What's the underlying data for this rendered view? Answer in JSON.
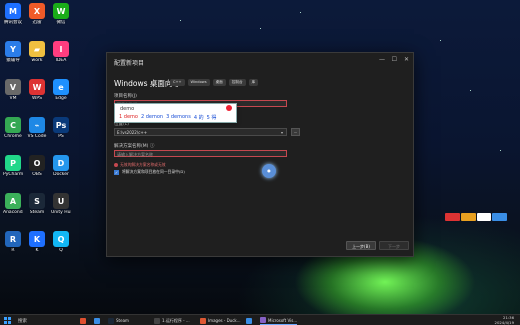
{
  "desktop_icons": [
    {
      "label": "腾讯会议",
      "color": "#1e6fff",
      "glyph": "M"
    },
    {
      "label": "迅雷",
      "color": "#f05a28",
      "glyph": "X"
    },
    {
      "label": "微信",
      "color": "#1aad19",
      "glyph": "W"
    },
    {
      "label": "猿辅导",
      "color": "#2b7de9",
      "glyph": "Y"
    },
    {
      "label": "work",
      "color": "#f0c040",
      "glyph": "▰"
    },
    {
      "label": "IDEA",
      "color": "#ff3d7f",
      "glyph": "I"
    },
    {
      "label": "VM",
      "color": "#696969",
      "glyph": "V"
    },
    {
      "label": "WPS",
      "color": "#d33",
      "glyph": "W"
    },
    {
      "label": "Edge",
      "color": "#1e90ff",
      "glyph": "e"
    },
    {
      "label": "Chrome",
      "color": "#34a853",
      "glyph": "C"
    },
    {
      "label": "VS Code",
      "color": "#1e88e5",
      "glyph": "⌁"
    },
    {
      "label": "PS",
      "color": "#0a3a7a",
      "glyph": "Ps"
    },
    {
      "label": "PyCharm",
      "color": "#21d789",
      "glyph": "P"
    },
    {
      "label": "OBS",
      "color": "#222",
      "glyph": "O"
    },
    {
      "label": "Docker",
      "color": "#2496ed",
      "glyph": "D"
    },
    {
      "label": "Anaconda",
      "color": "#3bb05a",
      "glyph": "A"
    },
    {
      "label": "Steam",
      "color": "#1b2838",
      "glyph": "S"
    },
    {
      "label": "Unity Hub",
      "color": "#333",
      "glyph": "U"
    },
    {
      "label": "R",
      "color": "#2266bb",
      "glyph": "R"
    },
    {
      "label": "K",
      "color": "#1e6fff",
      "glyph": "K"
    },
    {
      "label": "Q",
      "color": "#12b7f5",
      "glyph": "Q"
    }
  ],
  "dialog": {
    "window_title": "配置新项目",
    "minimize": "—",
    "maximize": "☐",
    "close": "✕",
    "heading": "Windows 桌面向导",
    "tags": [
      "C++",
      "Windows",
      "桌面",
      "控制台",
      "库"
    ],
    "project_name_label": "项目名称(J)",
    "project_name_value": "项目名称(J)",
    "location_label": "位置(L)",
    "location_value": "E:\\vs2022\\c++",
    "browse_label": "...",
    "solution_name_label": "解决方案名称(M) ⓘ",
    "solution_name_placeholder": "请输入解决方案名称",
    "error_text": "无效的解决方案名称或无效",
    "checkbox_label": "将解决方案和项目放在同一目录中(D)",
    "back_button": "上一步(B)",
    "next_button": "下一步"
  },
  "ime": {
    "typed": "demo",
    "candidates": [
      "1 demo",
      "2 demon",
      "3 demons",
      "4 的",
      "5 得"
    ]
  },
  "taskbar": {
    "search_placeholder": "搜索",
    "items": [
      {
        "label": "",
        "color": "#e05030"
      },
      {
        "label": "",
        "color": "#3a8ee6"
      },
      {
        "label": "Steam",
        "color": "#1b2838"
      },
      {
        "label": "1.运行程序 - ...",
        "color": "#444"
      },
      {
        "label": "Images - Duck...",
        "color": "#de5833"
      },
      {
        "label": "",
        "color": "#3a8ee6"
      },
      {
        "label": "Microsoft Vis...",
        "color": "#8661c5"
      }
    ],
    "time": "21:36",
    "date": "2024/4/19"
  }
}
